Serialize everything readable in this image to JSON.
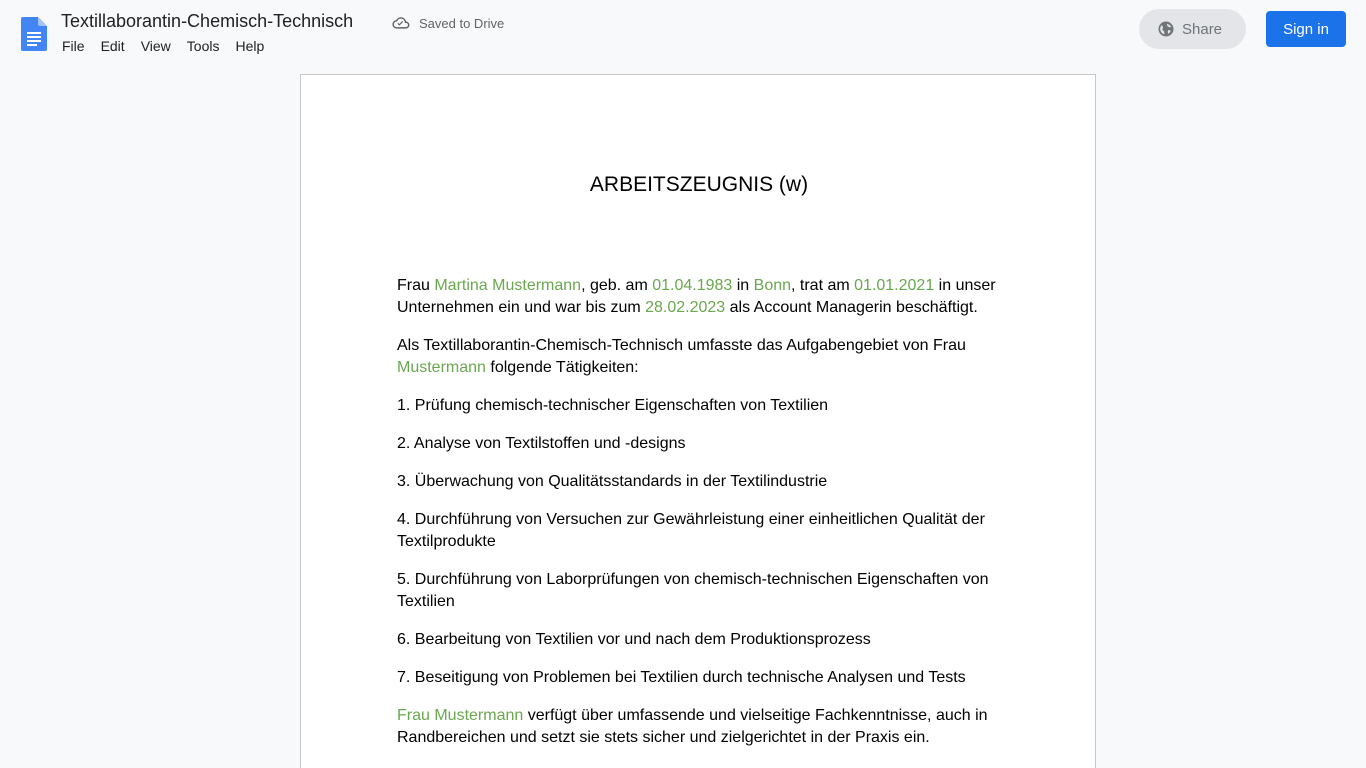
{
  "header": {
    "title": "Textillaborantin-Chemisch-Technisch",
    "saved_status": "Saved to Drive",
    "menu": [
      "File",
      "Edit",
      "View",
      "Tools",
      "Help"
    ],
    "share_label": "Share",
    "signin_label": "Sign in",
    "icons": {
      "doc": "google-docs-icon",
      "cloud": "cloud-saved-icon",
      "globe": "globe-icon"
    }
  },
  "colors": {
    "accent_blue": "#1a73e8",
    "highlight_green": "#6aa84f"
  },
  "document": {
    "heading": "ARBEITSZEUGNIS (w)",
    "p1": {
      "t1": "Frau ",
      "name": "Martina Mustermann",
      "t2": ", geb. am ",
      "birth": "01.04.1983",
      "t3": " in ",
      "city": "Bonn",
      "t4": ", trat am ",
      "start": "01.01.2021",
      "t5": " in unser Unternehmen ein und war bis zum ",
      "end": "28.02.2023",
      "t6": " als Account Managerin beschäftigt."
    },
    "p2": {
      "t1": "Als Textillaborantin-Chemisch-Technisch umfasste das Aufgabengebiet von Frau ",
      "name": "Mustermann",
      "t2": " folgende Tätigkeiten:"
    },
    "tasks": [
      "1. Prüfung chemisch-technischer Eigenschaften von Textilien",
      "2. Analyse von Textilstoffen und -designs",
      "3. Überwachung von Qualitätsstandards in der Textilindustrie",
      "4. Durchführung von Versuchen zur Gewährleistung einer einheitlichen Qualität der Textilprodukte",
      "5. Durchführung von Laborprüfungen von chemisch-technischen Eigenschaften von Textilien",
      "6. Bearbeitung von Textilien vor und nach dem Produktionsprozess",
      "7. Beseitigung von Problemen bei Textilien durch technische Analysen und Tests"
    ],
    "p3": {
      "name": "Frau Mustermann",
      "t1": " verfügt über umfassende und vielseitige Fachkenntnisse, auch in Randbereichen und setzt sie stets sicher und zielgerichtet in der Praxis ein."
    }
  }
}
